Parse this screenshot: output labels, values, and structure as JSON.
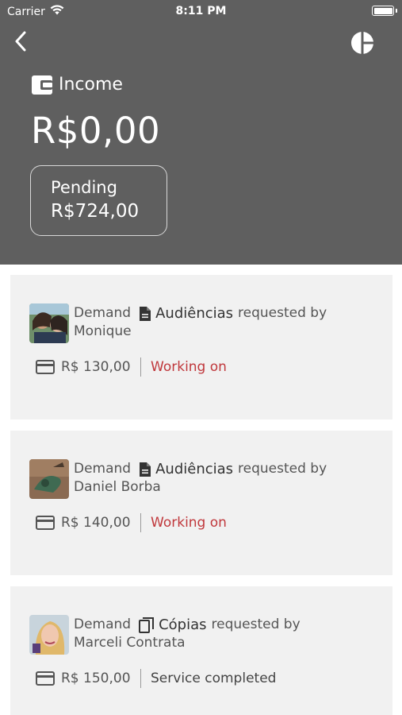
{
  "status_bar": {
    "carrier": "Carrier",
    "time": "8:11 PM"
  },
  "header": {
    "income_label": "Income",
    "income_amount": "R$0,00",
    "pending_label": "Pending",
    "pending_amount": "R$724,00",
    "background_color": "#5f5f5f"
  },
  "demands": [
    {
      "type_label": "Demand",
      "service_icon": "document-icon",
      "service": "Audiências",
      "requested_by_label": "requested by",
      "requester": "Monique",
      "price": "R$ 130,00",
      "status": "Working on",
      "status_color": "#c0383c"
    },
    {
      "type_label": "Demand",
      "service_icon": "document-icon",
      "service": "Audiências",
      "requested_by_label": "requested by",
      "requester": "Daniel Borba",
      "price": "R$ 140,00",
      "status": "Working on",
      "status_color": "#c0383c"
    },
    {
      "type_label": "Demand",
      "service_icon": "copy-icon",
      "service": "Cópias",
      "requested_by_label": "requested by",
      "requester": "Marceli Contrata",
      "price": "R$ 150,00",
      "status": "Service completed",
      "status_color": "#444444"
    }
  ]
}
